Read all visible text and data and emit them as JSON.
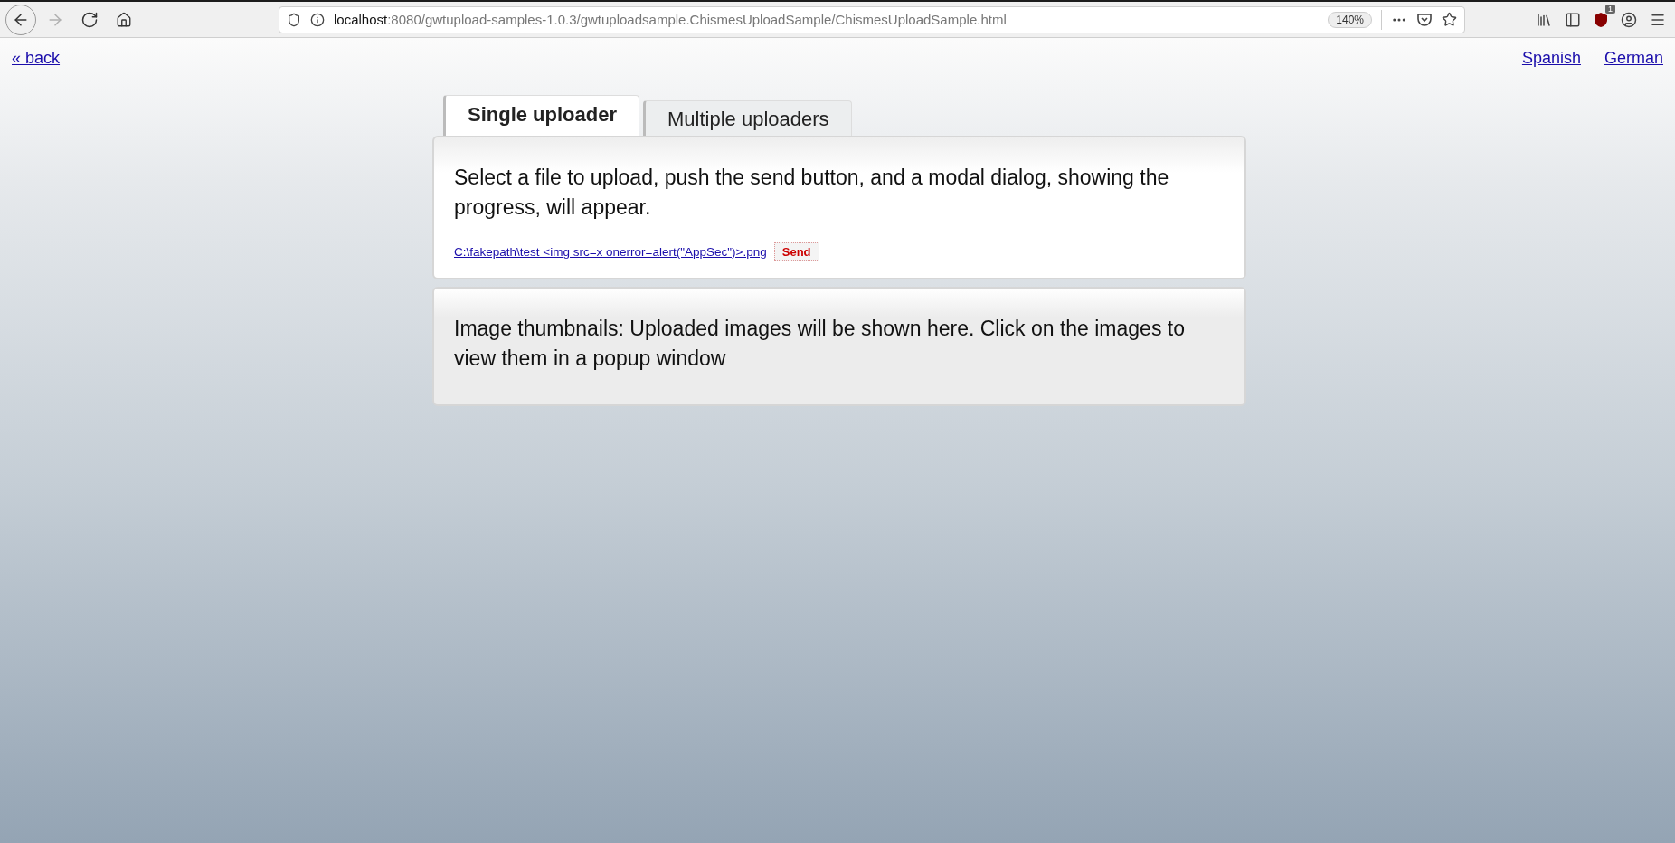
{
  "browser": {
    "nav": [
      {
        "kind": "back",
        "disabled": false
      },
      {
        "kind": "forward",
        "disabled": true
      },
      {
        "kind": "reload",
        "disabled": false
      },
      {
        "kind": "home",
        "disabled": false
      }
    ],
    "url": {
      "host": "localhost",
      "path": ":8080/gwtupload-samples-1.0.3/gwtuploadsample.ChismesUploadSample/ChismesUploadSample.html"
    },
    "zoom": "140%",
    "extension_badge": "1"
  },
  "header": {
    "back_link": "« back",
    "languages": [
      "Spanish",
      "German"
    ]
  },
  "tabs": [
    {
      "label": "Single uploader",
      "selected": true
    },
    {
      "label": "Multiple uploaders",
      "selected": false
    }
  ],
  "upload_panel": {
    "text": "Select a file to upload, push the send button, and a modal dialog, showing the progress, will appear.",
    "file": "C:\\fakepath\\test <img src=x onerror=alert(\"AppSec\")>.png",
    "send_button": "Send"
  },
  "thumbnails_panel": {
    "text": "Image thumbnails: Uploaded images will be shown here. Click on the images to view them in a popup window"
  }
}
